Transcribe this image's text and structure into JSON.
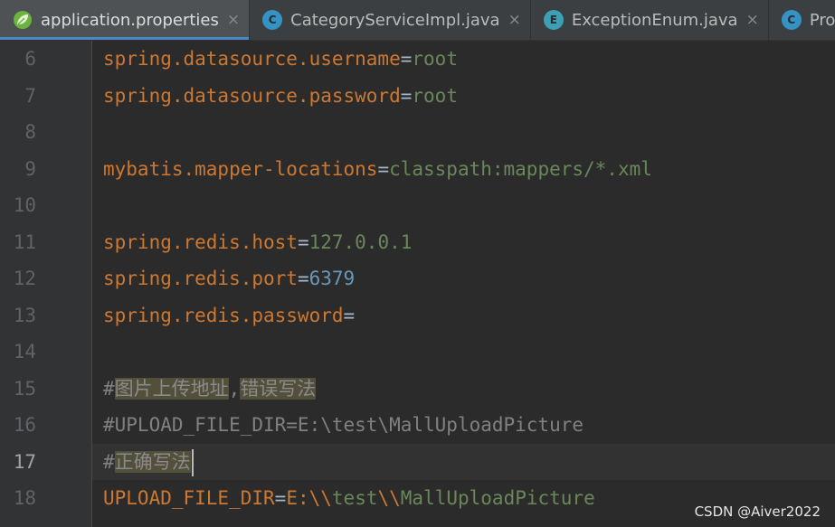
{
  "tabs": [
    {
      "label": "application.properties",
      "icon": "spring-leaf-icon",
      "active": true
    },
    {
      "label": "CategoryServiceImpl.java",
      "icon": "class-icon",
      "icon_letter": "C"
    },
    {
      "label": "ExceptionEnum.java",
      "icon": "enum-icon",
      "icon_letter": "E"
    },
    {
      "label": "Product",
      "icon": "class-icon",
      "icon_letter": "C"
    }
  ],
  "close_glyph": "×",
  "lines": [
    {
      "num": "6",
      "key": "spring.datasource.username",
      "eq": "=",
      "val": "root"
    },
    {
      "num": "7",
      "key": "spring.datasource.password",
      "eq": "=",
      "val": "root"
    },
    {
      "num": "8"
    },
    {
      "num": "9",
      "key": "mybatis.mapper-locations",
      "eq": "=",
      "val": "classpath:mappers/*.xml"
    },
    {
      "num": "10"
    },
    {
      "num": "11",
      "key": "spring.redis.host",
      "eq": "=",
      "val": "127.0.0.1"
    },
    {
      "num": "12",
      "key": "spring.redis.port",
      "eq": "=",
      "val": "6379"
    },
    {
      "num": "13",
      "key": "spring.redis.password",
      "eq": "="
    },
    {
      "num": "14"
    },
    {
      "num": "15",
      "hash": "#",
      "cjk_a": "图片上传地址",
      "sep": ",",
      "cjk_b": "错误写法"
    },
    {
      "num": "16",
      "comment": "#UPLOAD_FILE_DIR=E:\\test\\MallUploadPicture"
    },
    {
      "num": "17",
      "hash": "#",
      "cjk_a": "正确写法"
    },
    {
      "num": "18",
      "k1": "UPLOAD_FILE_DIR",
      "eq": "=",
      "v1": "E:",
      "e1": "\\\\",
      "v2": "test",
      "e2": "\\\\",
      "v3": "MallUploadPicture"
    }
  ],
  "current_line": "17",
  "watermark": "CSDN @Aiver2022",
  "colors": {
    "background": "#2b2b2b",
    "gutter": "#313335",
    "key": "#cc7832",
    "value": "#6a8759",
    "number": "#6897bb",
    "comment": "#808080",
    "tab_accent": "#4a88c7"
  }
}
